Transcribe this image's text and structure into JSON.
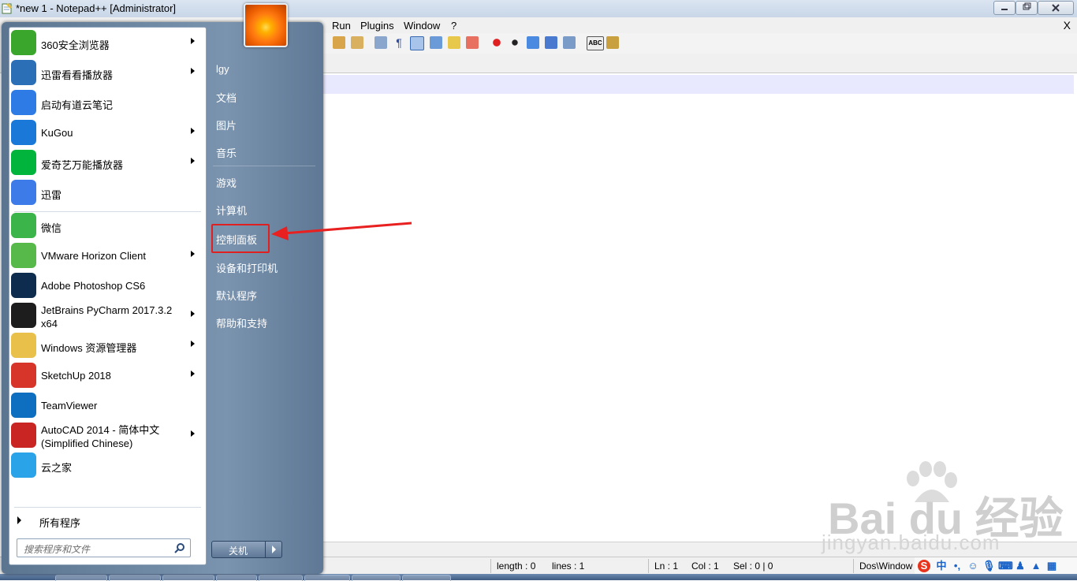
{
  "window": {
    "title": "*new  1 - Notepad++ [Administrator]"
  },
  "menu": {
    "items": [
      "Run",
      "Plugins",
      "Window",
      "?"
    ],
    "close": "X"
  },
  "status": {
    "length": "length : 0",
    "lines": "lines : 1",
    "ln": "Ln : 1",
    "col": "Col : 1",
    "sel": "Sel : 0 | 0",
    "eol": "Dos\\Window"
  },
  "ime": {
    "lang": "中"
  },
  "start_menu": {
    "programs": [
      {
        "label": "360安全浏览器",
        "icon": "browser-360-icon",
        "submenu": true,
        "color": "#3aa62b"
      },
      {
        "label": "迅雷看看播放器",
        "icon": "xunlei-player-icon",
        "submenu": true,
        "color": "#2b6fb6"
      },
      {
        "label": "启动有道云笔记",
        "icon": "youdao-note-icon",
        "submenu": false,
        "color": "#2f7be6"
      },
      {
        "label": "KuGou",
        "icon": "kugou-icon",
        "submenu": true,
        "color": "#1a79d8"
      },
      {
        "label": "爱奇艺万能播放器",
        "icon": "iqiyi-icon",
        "submenu": true,
        "color": "#00b43c"
      },
      {
        "label": "迅雷",
        "icon": "xunlei-icon",
        "submenu": false,
        "color": "#3c7be8"
      },
      {
        "label": "微信",
        "icon": "wechat-icon",
        "submenu": false,
        "color": "#3bb54a"
      },
      {
        "label": "VMware Horizon Client",
        "icon": "vmware-horizon-icon",
        "submenu": true,
        "color": "#56b949"
      },
      {
        "label": "Adobe Photoshop CS6",
        "icon": "photoshop-icon",
        "submenu": false,
        "color": "#0e2c4d"
      },
      {
        "label": "JetBrains PyCharm 2017.3.2 x64",
        "icon": "pycharm-icon",
        "submenu": true,
        "color": "#1d1d1d"
      },
      {
        "label": "Windows 资源管理器",
        "icon": "explorer-icon",
        "submenu": true,
        "color": "#e8c04a"
      },
      {
        "label": "SketchUp 2018",
        "icon": "sketchup-icon",
        "submenu": true,
        "color": "#d8352a"
      },
      {
        "label": "TeamViewer",
        "icon": "teamviewer-icon",
        "submenu": false,
        "color": "#0e6fc1"
      },
      {
        "label": "AutoCAD 2014 - 简体中文 (Simplified Chinese)",
        "icon": "autocad-icon",
        "submenu": true,
        "color": "#c92522"
      },
      {
        "label": "云之家",
        "icon": "yunzhijia-icon",
        "submenu": false,
        "color": "#2aa3e8"
      }
    ],
    "all_programs": "所有程序",
    "search_placeholder": "搜索程序和文件",
    "right_items": [
      "lgy",
      "文档",
      "图片",
      "音乐",
      "游戏",
      "计算机",
      "控制面板",
      "设备和打印机",
      "默认程序",
      "帮助和支持"
    ],
    "shutdown": "关机",
    "highlight_color": "#e02020"
  },
  "watermark": {
    "brand": "Bai du 经验",
    "url": "jingyan.baidu.com"
  }
}
